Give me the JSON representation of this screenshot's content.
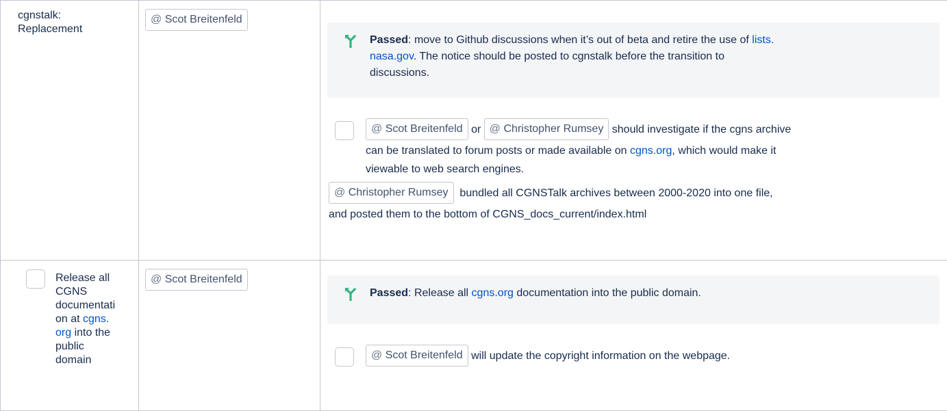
{
  "rows": [
    {
      "topic_lines": [
        "cgnstalk:",
        "Replacement"
      ],
      "owner": "Scot Breitenfeld",
      "decision": {
        "label": "Passed",
        "text_before_link": ": move to Github discussions when it’s out of beta and retire the use of ",
        "link_part1": "lists.",
        "link_part2": "nasa.gov",
        "text_after_link": ". The notice should be posted to cgnstalk before the transition to",
        "line3": "discussions."
      },
      "task": {
        "mention1": "Scot Breitenfeld",
        "connector": "or",
        "mention2": "Christopher Rumsey",
        "text1": "should investigate if the cgns archive",
        "text2": "can be translated to forum posts or made available on ",
        "link": "cgns.org",
        "text2_after": ", which would make it",
        "text3": "viewable to web search engines."
      },
      "note": {
        "mention": "Christopher Rumsey",
        "text1": "bundled all CGNSTalk archives between 2000-2020 into one file,",
        "text2": "and posted them to the bottom of CGNS_docs_current/index.html"
      }
    },
    {
      "topic": {
        "lines": [
          "Release all",
          "CGNS",
          "documentati",
          "on at "
        ],
        "link1": "cgns.",
        "link2": "org",
        "after_link": " into the",
        "lines_end": [
          "public",
          "domain"
        ]
      },
      "owner": "Scot Breitenfeld",
      "decision": {
        "label": "Passed",
        "text_before_link": ": Release all ",
        "link": "cgns.org",
        "text_after_link": " documentation into the public domain."
      },
      "task": {
        "mention": "Scot Breitenfeld",
        "text": "will update the copyright information on the webpage."
      }
    }
  ],
  "mention_prefix": "@",
  "icons": {
    "decision": "decision-branch-icon",
    "task": "checkbox"
  },
  "colors": {
    "link": "#0052cc",
    "decision_icon": "#36b37e",
    "panel_bg": "#f4f5f7",
    "border": "#c1c7d0"
  }
}
